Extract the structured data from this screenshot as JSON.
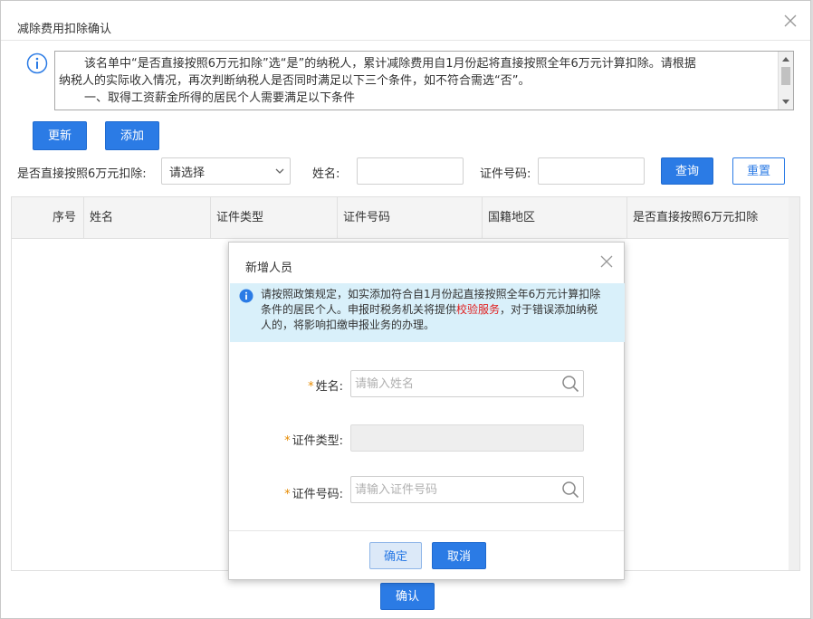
{
  "dialog": {
    "title": "减除费用扣除确认",
    "notice_lines": [
      "该名单中“是否直接按照6万元扣除”选“是”的纳税人，累计减除费用自1月份起将直接按照全年6万元计算扣除。请根据",
      "纳税人的实际收入情况，再次判断纳税人是否同时满足以下三个条件，如不符合需选“否”。",
      "一、取得工资薪金所得的居民个人需要满足以下条件"
    ]
  },
  "toolbar": {
    "update_label": "更新",
    "add_label": "添加"
  },
  "filters": {
    "direct_label": "是否直接按照6万元扣除:",
    "direct_selected": "请选择",
    "name_label": "姓名:",
    "id_label": "证件号码:",
    "query_label": "查询",
    "reset_label": "重置"
  },
  "table": {
    "columns": [
      "序号",
      "姓名",
      "证件类型",
      "证件号码",
      "国籍地区",
      "是否直接按照6万元扣除"
    ],
    "rows": []
  },
  "confirm_label": "确认",
  "modal": {
    "title": "新增人员",
    "info_line1": "请按照政策规定，如实添加符合自1月份起直接按照全年6万元计算扣除",
    "info_line2_pre": "条件的居民个人。申报时税务机关将提供",
    "info_link": "校验服务",
    "info_line2_post": "，对于错误添加纳税",
    "info_line3": "人的，将影响扣缴申报业务的办理。",
    "name_label": "姓名:",
    "name_placeholder": "请输入姓名",
    "id_type_label": "证件类型:",
    "id_number_label": "证件号码:",
    "id_number_placeholder": "请输入证件号码",
    "ok_label": "确定",
    "cancel_label": "取消"
  },
  "colors": {
    "primary": "#2b7be5",
    "required": "#e68a00",
    "link": "#e02020",
    "info_bg": "#d9f0fa"
  }
}
